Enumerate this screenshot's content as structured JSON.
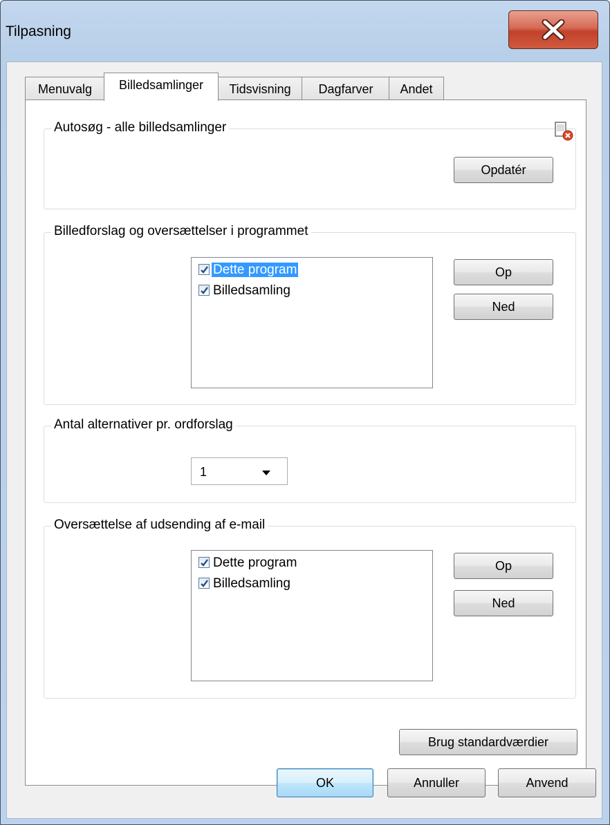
{
  "window": {
    "title": "Tilpasning"
  },
  "tabs": [
    "Menuvalg",
    "Billedsamlinger",
    "Tidsvisning",
    "Dagfarver",
    "Andet"
  ],
  "active_tab": "Billedsamlinger",
  "autosearch": {
    "legend": "Autosøg - alle billedsamlinger",
    "update_label": "Opdatér",
    "icon": "image-remove-icon"
  },
  "suggestions": {
    "legend": "Billedforslag og oversættelser i programmet",
    "items": [
      {
        "label": "Dette program",
        "checked": true,
        "selected": true
      },
      {
        "label": "Billedsamling",
        "checked": true,
        "selected": false
      }
    ],
    "up_label": "Op",
    "down_label": "Ned"
  },
  "alternatives": {
    "legend": "Antal alternativer pr. ordforslag",
    "value": "1"
  },
  "email": {
    "legend": "Oversættelse af udsending af e-mail",
    "items": [
      {
        "label": "Dette program",
        "checked": true,
        "selected": false
      },
      {
        "label": "Billedsamling",
        "checked": true,
        "selected": false
      }
    ],
    "up_label": "Op",
    "down_label": "Ned"
  },
  "defaults_label": "Brug standardværdier",
  "footer": {
    "ok_label": "OK",
    "cancel_label": "Annuller",
    "apply_label": "Anvend"
  },
  "colors": {
    "selection": "#3399ff",
    "close_button": "#c2412b"
  }
}
